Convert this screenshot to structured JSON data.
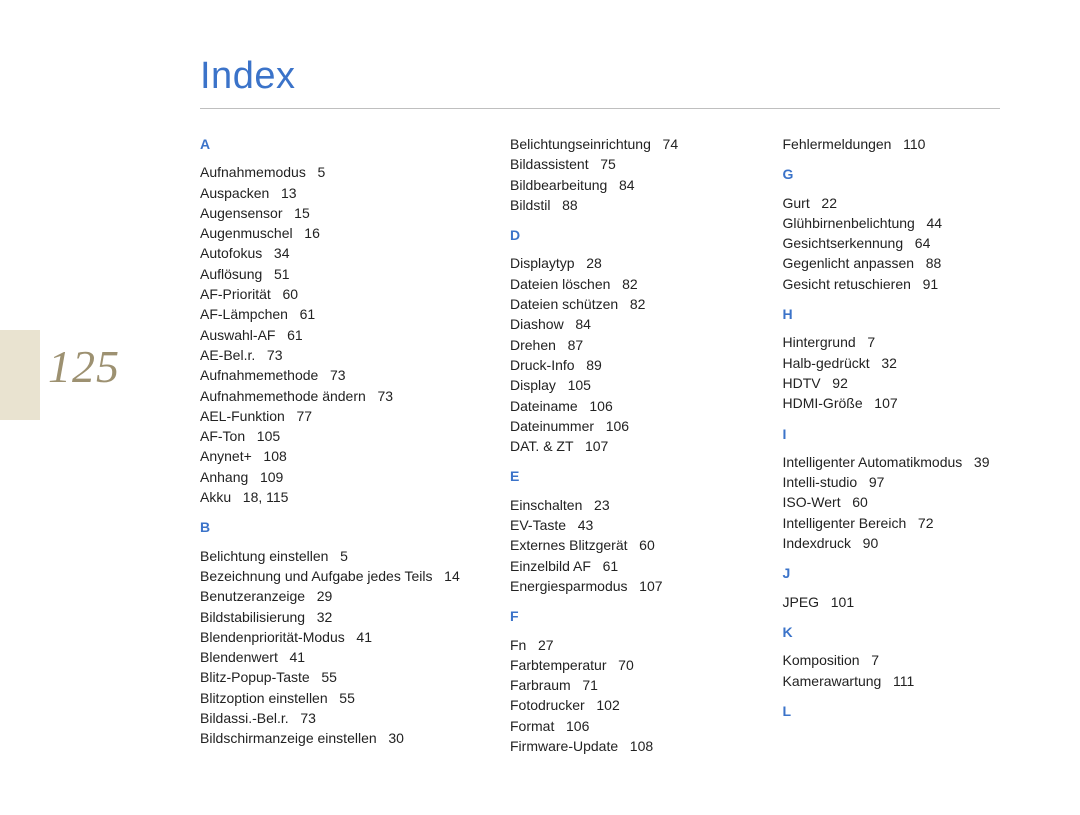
{
  "page_number": "125",
  "title": "Index",
  "index": {
    "A": [
      {
        "term": "Aufnahmemodus",
        "pages": "5"
      },
      {
        "term": "Auspacken",
        "pages": "13"
      },
      {
        "term": "Augensensor",
        "pages": "15"
      },
      {
        "term": "Augenmuschel",
        "pages": "16"
      },
      {
        "term": "Autofokus",
        "pages": "34"
      },
      {
        "term": "Auflösung",
        "pages": "51"
      },
      {
        "term": "AF-Priorität",
        "pages": "60"
      },
      {
        "term": "AF-Lämpchen",
        "pages": "61"
      },
      {
        "term": "Auswahl-AF",
        "pages": "61"
      },
      {
        "term": "AE-Bel.r.",
        "pages": "73"
      },
      {
        "term": "Aufnahmemethode",
        "pages": "73"
      },
      {
        "term": "Aufnahmemethode ändern",
        "pages": "73"
      },
      {
        "term": "AEL-Funktion",
        "pages": "77"
      },
      {
        "term": "AF-Ton",
        "pages": "105"
      },
      {
        "term": "Anynet+",
        "pages": "108"
      },
      {
        "term": "Anhang",
        "pages": "109"
      },
      {
        "term": "Akku",
        "pages": "18, 115"
      }
    ],
    "B": [
      {
        "term": "Belichtung einstellen",
        "pages": "5"
      },
      {
        "term": "Bezeichnung und Aufgabe jedes Teils",
        "pages": "14"
      },
      {
        "term": "Benutzeranzeige",
        "pages": "29"
      },
      {
        "term": "Bildstabilisierung",
        "pages": "32"
      },
      {
        "term": "Blendenpriorität-Modus",
        "pages": "41"
      },
      {
        "term": "Blendenwert",
        "pages": "41"
      },
      {
        "term": "Blitz-Popup-Taste",
        "pages": "55"
      },
      {
        "term": "Blitzoption einstellen",
        "pages": "55"
      },
      {
        "term": "Bildassi.-Bel.r.",
        "pages": "73"
      },
      {
        "term": "Bildschirmanzeige einstellen",
        "pages": "30"
      },
      {
        "term": "Belichtungseinrichtung",
        "pages": "74"
      },
      {
        "term": "Bildassistent",
        "pages": "75"
      },
      {
        "term": "Bildbearbeitung",
        "pages": "84"
      },
      {
        "term": "Bildstil",
        "pages": "88"
      }
    ],
    "D": [
      {
        "term": "Displaytyp",
        "pages": "28"
      },
      {
        "term": "Dateien löschen",
        "pages": "82"
      },
      {
        "term": "Dateien schützen",
        "pages": "82"
      },
      {
        "term": "Diashow",
        "pages": "84"
      },
      {
        "term": "Drehen",
        "pages": "87"
      },
      {
        "term": "Druck-Info",
        "pages": "89"
      },
      {
        "term": "Display",
        "pages": "105"
      },
      {
        "term": "Dateiname",
        "pages": "106"
      },
      {
        "term": "Dateinummer",
        "pages": "106"
      },
      {
        "term": "DAT. & ZT",
        "pages": "107"
      }
    ],
    "E": [
      {
        "term": "Einschalten",
        "pages": "23"
      },
      {
        "term": "EV-Taste",
        "pages": "43"
      },
      {
        "term": "Externes Blitzgerät",
        "pages": "60"
      },
      {
        "term": "Einzelbild AF",
        "pages": "61"
      },
      {
        "term": "Energiesparmodus",
        "pages": "107"
      }
    ],
    "F": [
      {
        "term": "Fn",
        "pages": "27"
      },
      {
        "term": "Farbtemperatur",
        "pages": "70"
      },
      {
        "term": "Farbraum",
        "pages": "71"
      },
      {
        "term": "Fotodrucker",
        "pages": "102"
      },
      {
        "term": "Format",
        "pages": "106"
      },
      {
        "term": "Firmware-Update",
        "pages": "108"
      },
      {
        "term": "Fehlermeldungen",
        "pages": "110"
      }
    ],
    "G": [
      {
        "term": "Gurt",
        "pages": "22"
      },
      {
        "term": "Glühbirnenbelichtung",
        "pages": "44"
      },
      {
        "term": "Gesichtserkennung",
        "pages": "64"
      },
      {
        "term": "Gegenlicht anpassen",
        "pages": "88"
      },
      {
        "term": "Gesicht retuschieren",
        "pages": "91"
      }
    ],
    "H": [
      {
        "term": "Hintergrund",
        "pages": "7"
      },
      {
        "term": "Halb-gedrückt",
        "pages": "32"
      },
      {
        "term": "HDTV",
        "pages": "92"
      },
      {
        "term": "HDMI-Größe",
        "pages": "107"
      }
    ],
    "I": [
      {
        "term": "Intelligenter Automatikmodus",
        "pages": "39"
      },
      {
        "term": "Intelli-studio",
        "pages": "97"
      },
      {
        "term": "ISO-Wert",
        "pages": "60"
      },
      {
        "term": "Intelligenter Bereich",
        "pages": "72"
      },
      {
        "term": "Indexdruck",
        "pages": "90"
      }
    ],
    "J": [
      {
        "term": "JPEG",
        "pages": "101"
      }
    ],
    "K": [
      {
        "term": "Komposition",
        "pages": "7"
      },
      {
        "term": "Kamerawartung",
        "pages": "111"
      }
    ],
    "L": []
  },
  "column_plan": [
    [
      "A",
      "B_part1"
    ],
    [
      "B_part2",
      "D",
      "E",
      "F_part1"
    ],
    [
      "F_part2",
      "G",
      "H",
      "I",
      "J",
      "K",
      "L"
    ]
  ],
  "split": {
    "B_part1_count": 10,
    "F_part1_count": 6
  }
}
